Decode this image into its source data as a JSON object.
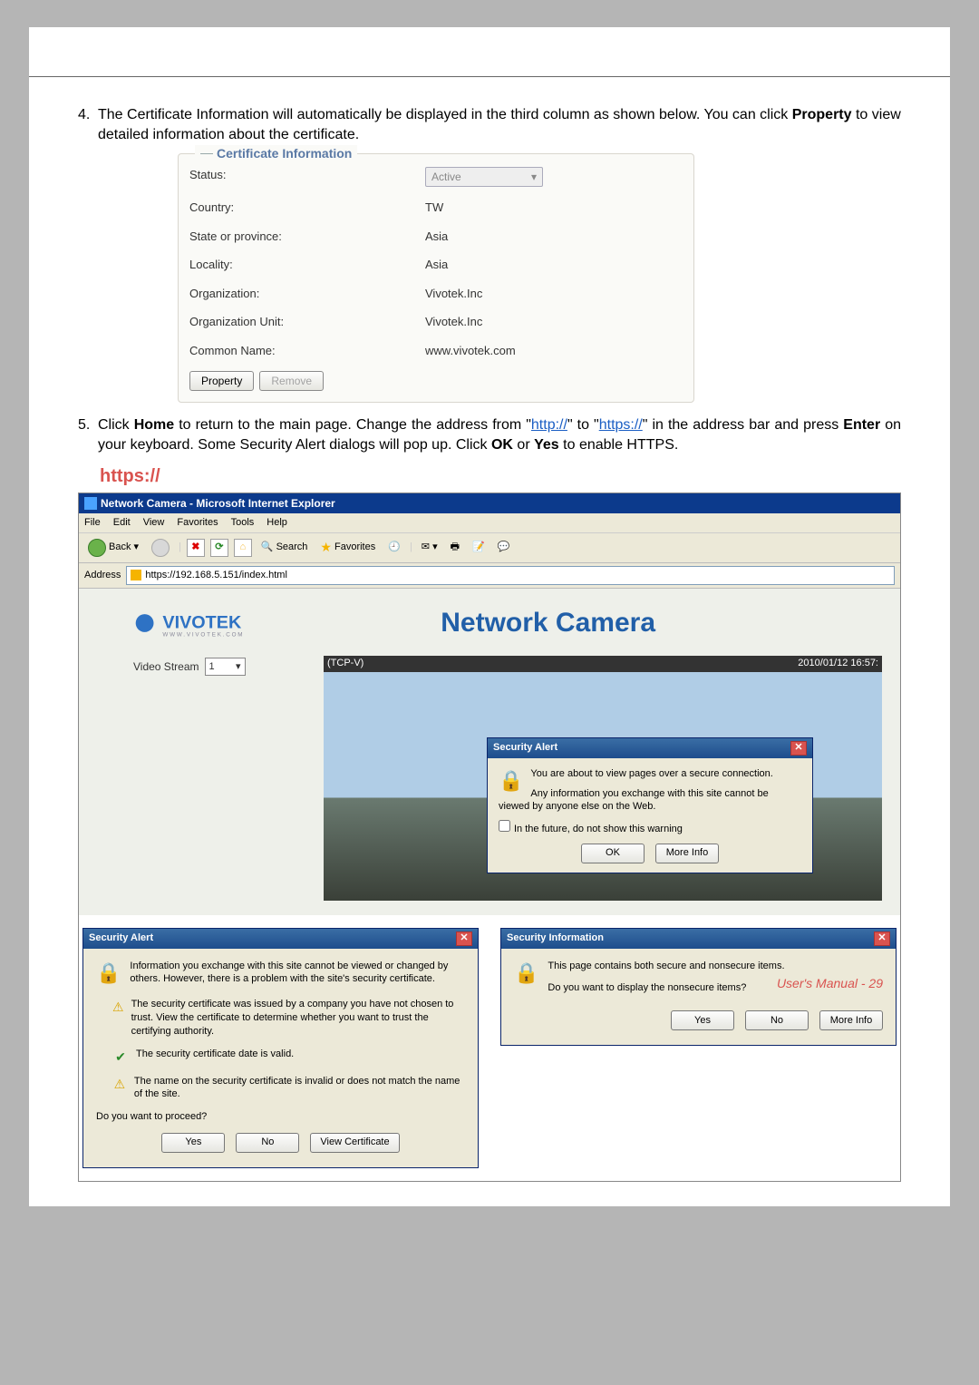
{
  "header": {
    "brand": "VIVOTEK"
  },
  "step4": {
    "num": "4.",
    "text_pre": "The Certificate Information will automatically be displayed in the third column as shown below. You can click ",
    "bold1": "Property",
    "text_post": " to view detailed information about the certificate."
  },
  "cert": {
    "legend": "Certificate Information",
    "rows": {
      "status_l": "Status:",
      "status_v": "Active",
      "country_l": "Country:",
      "country_v": "TW",
      "state_l": "State or province:",
      "state_v": "Asia",
      "locality_l": "Locality:",
      "locality_v": "Asia",
      "org_l": "Organization:",
      "org_v": "Vivotek.Inc",
      "orgunit_l": "Organization Unit:",
      "orgunit_v": "Vivotek.Inc",
      "cn_l": "Common Name:",
      "cn_v": "www.vivotek.com"
    },
    "btn_property": "Property",
    "btn_remove": "Remove"
  },
  "step5": {
    "num": "5.",
    "t1": "Click ",
    "home": "Home",
    "t2": " to return to the main page. Change the address from \"",
    "http": "http://",
    "t3": "\" to \"",
    "https": "https://",
    "t4": "\" in the address bar and press ",
    "enter": "Enter",
    "t5": " on your keyboard. Some Security Alert dialogs will pop up. Click ",
    "ok": "OK",
    "t6": " or ",
    "yes": "Yes",
    "t7": " to enable HTTPS."
  },
  "https_label": "https://",
  "browser": {
    "title": "Network Camera - Microsoft Internet Explorer",
    "menu": [
      "File",
      "Edit",
      "View",
      "Favorites",
      "Tools",
      "Help"
    ],
    "back": "Back",
    "search": "Search",
    "favorites": "Favorites",
    "addr_label": "Address",
    "url": "https://192.168.5.151/index.html"
  },
  "camera": {
    "title": "Network Camera",
    "vs_label": "Video Stream",
    "vs_value": "1",
    "codec": "(TCP-V)",
    "timestamp": "2010/01/12 16:57:"
  },
  "alert1": {
    "title": "Security Alert",
    "p1": "You are about to view pages over a secure connection.",
    "p2": "Any information you exchange with this site cannot be viewed by anyone else on the Web.",
    "chk": "In the future, do not show this warning",
    "ok": "OK",
    "more": "More Info"
  },
  "alert2": {
    "title": "Security Alert",
    "p1": "Information you exchange with this site cannot be viewed or changed by others. However, there is a problem with the site's security certificate.",
    "p2": "The security certificate was issued by a company you have not chosen to trust. View the certificate to determine whether you want to trust the certifying authority.",
    "p3": "The security certificate date is valid.",
    "p4": "The name on the security certificate is invalid or does not match the name of the site.",
    "q": "Do you want to proceed?",
    "yes": "Yes",
    "no": "No",
    "view": "View Certificate"
  },
  "alert3": {
    "title": "Security Information",
    "p1": "This page contains both secure and nonsecure items.",
    "q": "Do you want to display the nonsecure items?",
    "yes": "Yes",
    "no": "No",
    "more": "More Info"
  },
  "footer": "User's Manual - 29"
}
